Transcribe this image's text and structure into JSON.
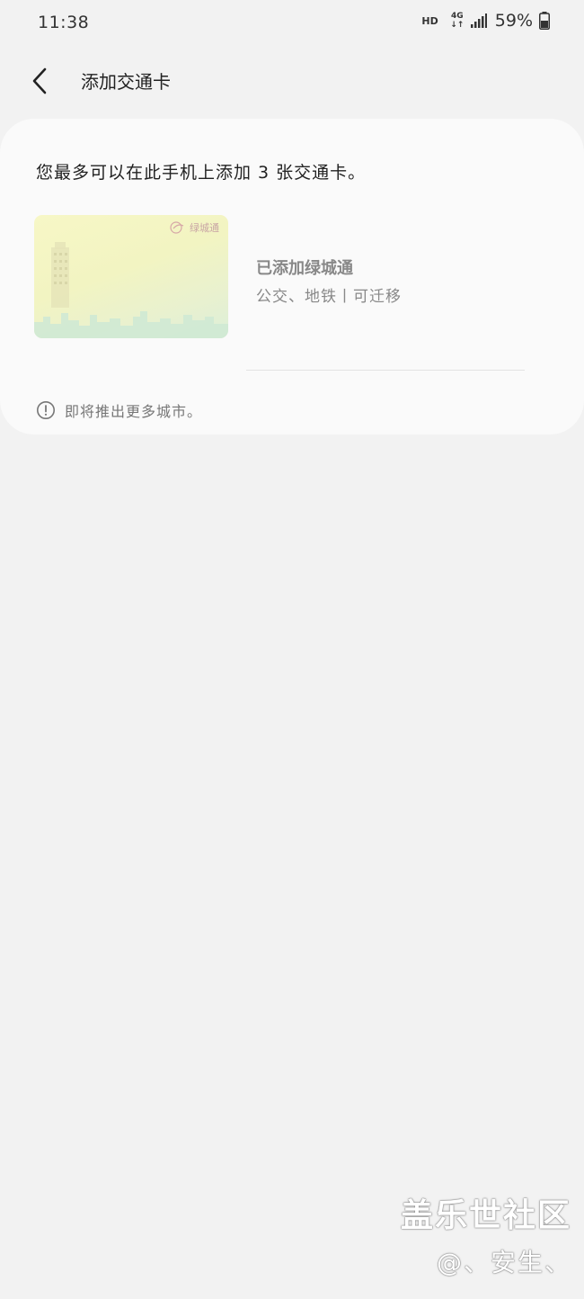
{
  "status_bar": {
    "time": "11:38",
    "hd": "HD",
    "network": "4G",
    "network_arrows": "↓↑",
    "battery": "59%"
  },
  "header": {
    "title": "添加交通卡"
  },
  "panel": {
    "limit_text": "您最多可以在此手机上添加 3 张交通卡。",
    "card": {
      "logo_text": "绿城通",
      "name": "已添加绿城通",
      "description": "公交、地铁丨可迁移"
    },
    "notice": "即将推出更多城市。"
  },
  "watermark": {
    "title": "盖乐世社区",
    "user": "@、安生、"
  }
}
